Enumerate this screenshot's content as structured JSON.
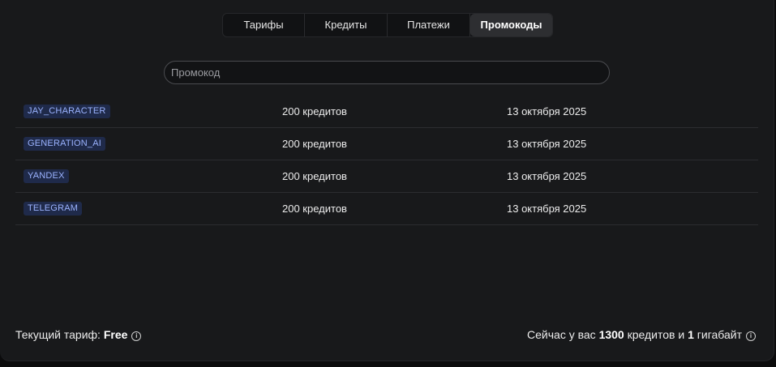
{
  "tabs": [
    {
      "label": "Тарифы",
      "active": false
    },
    {
      "label": "Кредиты",
      "active": false
    },
    {
      "label": "Платежи",
      "active": false
    },
    {
      "label": "Промокоды",
      "active": true
    }
  ],
  "search": {
    "placeholder": "Промокод",
    "value": ""
  },
  "promocodes": [
    {
      "code": "JAY_CHARACTER",
      "amount": "200 кредитов",
      "date": "13 октября 2025"
    },
    {
      "code": "GENERATION_AI",
      "amount": "200 кредитов",
      "date": "13 октября 2025"
    },
    {
      "code": "YANDEX",
      "amount": "200 кредитов",
      "date": "13 октября 2025"
    },
    {
      "code": "TELEGRAM",
      "amount": "200 кредитов",
      "date": "13 октября 2025"
    }
  ],
  "footer": {
    "plan_label": "Текущий тариф:",
    "plan_value": "Free",
    "balance_prefix": "Сейчас у вас",
    "credits_value": "1300",
    "credits_word": "кредитов и",
    "storage_value": "1",
    "storage_word": "гигабайт",
    "info_icon": "info-icon"
  },
  "colors": {
    "background": "#18191b",
    "badge_bg": "#1f2a4a",
    "badge_text": "#9bb3ff",
    "active_tab": "#2d2e31"
  }
}
